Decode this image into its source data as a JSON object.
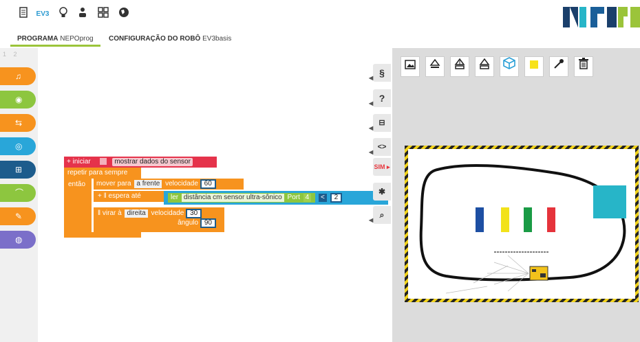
{
  "topbar": {
    "icons": [
      "document-icon",
      "ev3-icon",
      "lightbulb-icon",
      "user-icon",
      "gallery-icon",
      "globe-icon"
    ],
    "ev3_label": "EV3"
  },
  "tabs": [
    {
      "prefix": "PROGRAMA",
      "name": "NEPOprog"
    },
    {
      "prefix": "CONFIGURAÇÃO DO ROBÔ",
      "name": "EV3basis"
    }
  ],
  "level_tabs": [
    "1",
    "2"
  ],
  "toolbox": {
    "colors": [
      "#f7931e",
      "#8dc63f",
      "#f7931e",
      "#29a6d9",
      "#1d5c8c",
      "#8dc63f",
      "#f7931e",
      "#7b6fc9"
    ]
  },
  "blocks": {
    "start_label": "+ iniciar",
    "show_sensor_label": "mostrar dados do sensor",
    "repeat_label": "repetir para sempre",
    "then_label": "então",
    "move_label": "mover",
    "para_label": "para",
    "direction_value": "a frente",
    "velocity_label": "velocidade",
    "move_speed": "60",
    "wait_label": "+ ‖ espera até",
    "read_label": "ler",
    "sensor_value": "distância cm sensor ultra-sônico",
    "port_label": "Port",
    "port_value": "4",
    "compare_op": "<",
    "compare_value": "2",
    "turn_label": "‖ virar à",
    "turn_direction": "direita",
    "turn_velocity_label": "velocidade",
    "turn_speed": "30",
    "angle_label": "ângulo",
    "angle_value": "90"
  },
  "side_buttons": [
    "§",
    "?",
    "⊟",
    "<>",
    "SIM",
    "✱",
    "⌕"
  ],
  "sim": {
    "tools": [
      "image-icon",
      "eject-icon",
      "robot-import-icon",
      "robot-export-icon",
      "cube-icon",
      "yellow-square-icon",
      "pipette-icon",
      "trash-icon"
    ],
    "accent": "#2a9fd6",
    "blocks_colors": [
      "#1d4fa3",
      "#f2e21b",
      "#1a9b45",
      "#e5333b"
    ],
    "obstacle_color": "#27b5c8"
  }
}
